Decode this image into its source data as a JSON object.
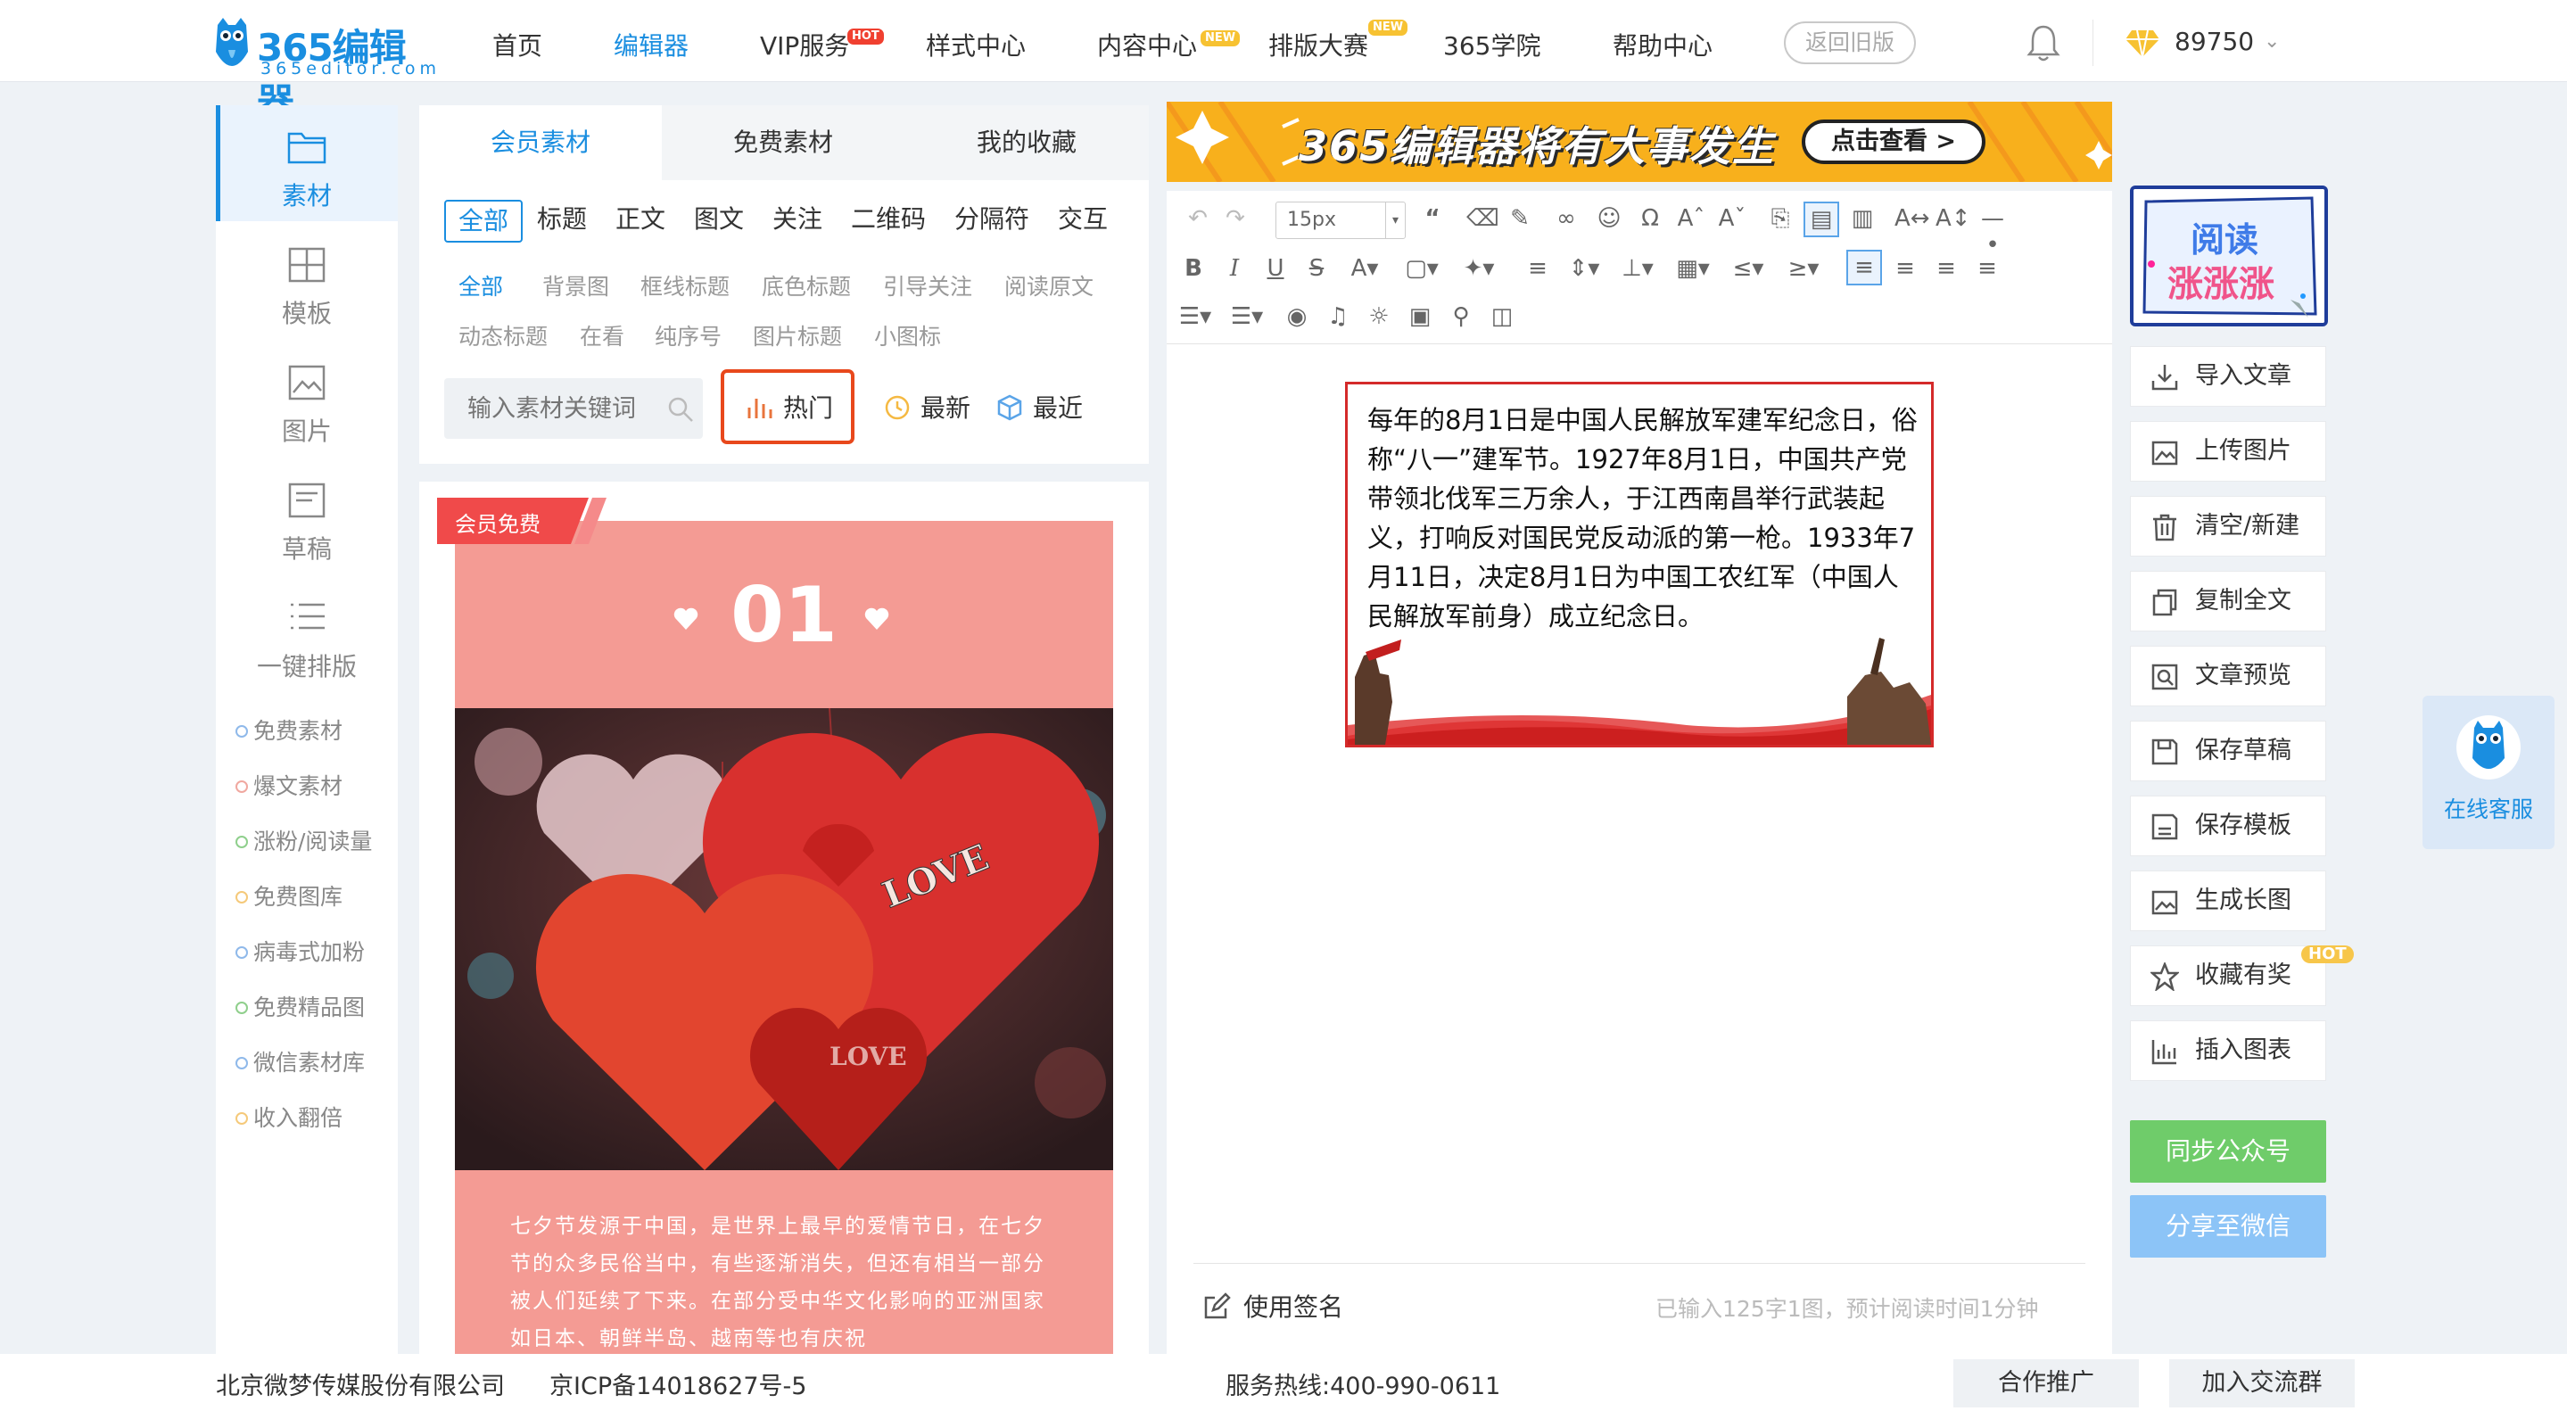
{
  "brand": {
    "name": "365编辑器",
    "sub": "365editor.com"
  },
  "nav": [
    {
      "label": "首页"
    },
    {
      "label": "编辑器",
      "active": true
    },
    {
      "label": "VIP服务",
      "tag": "HOT"
    },
    {
      "label": "样式中心"
    },
    {
      "label": "内容中心",
      "tag": "NEW"
    },
    {
      "label": "排版大赛",
      "tag": "NEW"
    },
    {
      "label": "365学院"
    },
    {
      "label": "帮助中心"
    }
  ],
  "header": {
    "old_version_label": "返回旧版",
    "points": "89750"
  },
  "left_nav": {
    "items": [
      {
        "label": "素材",
        "icon": "folder-icon",
        "active": true
      },
      {
        "label": "模板",
        "icon": "layout-icon"
      },
      {
        "label": "图片",
        "icon": "image-icon"
      },
      {
        "label": "草稿",
        "icon": "draft-icon"
      },
      {
        "label": "一键排版",
        "icon": "list-icon"
      }
    ],
    "links": [
      "免费素材",
      "爆文素材",
      "涨粉/阅读量",
      "免费图库",
      "病毒式加粉",
      "免费精品图",
      "微信素材库",
      "收入翻倍"
    ],
    "link_colors": [
      "#8fb9ea",
      "#f0a8a0",
      "#8fcf8c",
      "#f5c97a",
      "#8fb9ea",
      "#8fcf8c",
      "#8fb9ea",
      "#f5c97a"
    ]
  },
  "materials": {
    "tabs": [
      "会员素材",
      "免费素材",
      "我的收藏"
    ],
    "categories": [
      "全部",
      "标题",
      "正文",
      "图文",
      "关注",
      "二维码",
      "分隔符",
      "交互"
    ],
    "subcategories": [
      "全部",
      "背景图",
      "框线标题",
      "底色标题",
      "引导关注",
      "阅读原文",
      "动态标题",
      "在看",
      "纯序号",
      "图片标题",
      "小图标"
    ],
    "search_placeholder": "输入素材关键词",
    "sort": {
      "hot": "热门",
      "newest": "最新",
      "recent": "最近"
    }
  },
  "card": {
    "badge": "会员免费",
    "number": "01",
    "image_text_1": "LOVE",
    "image_text_2": "LOVE",
    "body": "七夕节发源于中国，是世界上最早的爱情节日，在七夕节的众多民俗当中，有些逐渐消失，但还有相当一部分被人们延续了下来。在部分受中华文化影响的亚洲国家如日本、朝鲜半岛、越南等也有庆祝"
  },
  "banner": {
    "text": "365编辑器将有大事发生",
    "button": "点击查看 >"
  },
  "toolbar": {
    "font_size": "15px"
  },
  "editor": {
    "article": "每年的8月1日是中国人民解放军建军纪念日，俗称“八一”建军节。1927年8月1日，中国共产党带领北伐军三万余人，于江西南昌举行武装起义，打响反对国民党反动派的第一枪。1933年7月11日，决定8月1日为中国工农红军（中国人民解放军前身）成立纪念日。",
    "signature_label": "使用签名",
    "word_count": "已输入125字1图，预计阅读时间1分钟"
  },
  "right_tools": {
    "promo_line1": "阅读",
    "promo_line2": "涨涨涨",
    "buttons": [
      {
        "label": "导入文章",
        "icon": "import-icon"
      },
      {
        "label": "上传图片",
        "icon": "upload-image-icon"
      },
      {
        "label": "清空/新建",
        "icon": "trash-icon"
      },
      {
        "label": "复制全文",
        "icon": "copy-icon"
      },
      {
        "label": "文章预览",
        "icon": "preview-icon"
      },
      {
        "label": "保存草稿",
        "icon": "save-icon"
      },
      {
        "label": "保存模板",
        "icon": "template-icon"
      },
      {
        "label": "生成长图",
        "icon": "long-image-icon"
      },
      {
        "label": "收藏有奖",
        "icon": "star-icon"
      },
      {
        "label": "插入图表",
        "icon": "chart-icon"
      }
    ],
    "hot_tag": "HOT",
    "sync_label": "同步公众号",
    "share_label": "分享至微信",
    "customer_service": "在线客服"
  },
  "footer": {
    "company": "北京微梦传媒股份有限公司",
    "icp": "京ICP备14018627号-5",
    "hotline": "服务热线:400-990-0611",
    "btn_partner": "合作推广",
    "btn_group": "加入交流群"
  }
}
